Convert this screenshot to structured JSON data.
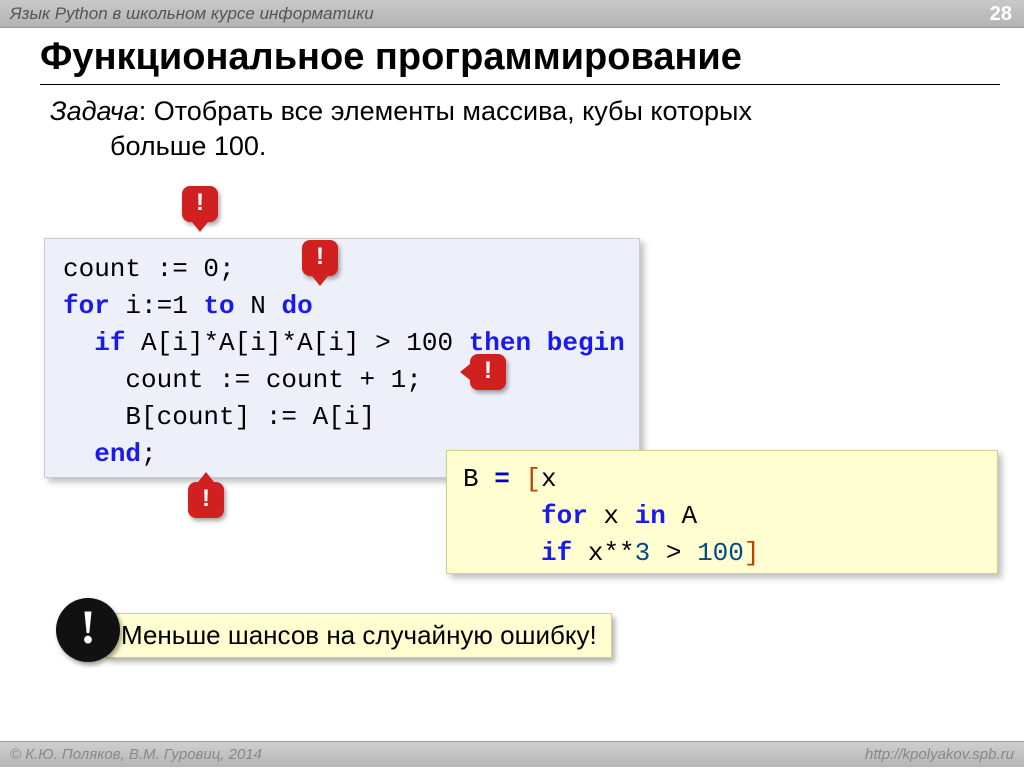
{
  "header": {
    "course": "Язык Python в школьном курсе информатики",
    "page": "28"
  },
  "title": "Функциональное программирование",
  "task": {
    "lead": "Задача",
    "line1": ": Отобрать все элементы массива, кубы которых",
    "line2": "больше 100."
  },
  "pascal": {
    "kw_for": "for",
    "kw_to": "to",
    "kw_do": "do",
    "kw_if": "if",
    "kw_then": "then",
    "kw_begin": "begin",
    "kw_end": "end",
    "line1a": "count := 0;",
    "line2_i": " i:=1 ",
    "line2_N": " N ",
    "line3_cond": " A[i]*A[i]*A[i] > 100 ",
    "line4": "    count := count + 1;",
    "line5": "    B[count] := A[i]",
    "semi": ";"
  },
  "python": {
    "lhs": "B ",
    "eq": "=",
    "lbr": " [",
    "rbr": "]",
    "x": "x",
    "kw_for": "for",
    "kw_in": "in",
    "kw_if": "if",
    "A": " A",
    "var_x2": " x ",
    "xpow": " x**",
    "n3": "3",
    "gt": " > ",
    "n100": "100",
    "pad": "     ",
    "pad2": "     "
  },
  "bubbles": {
    "b1": "!",
    "b2": "!",
    "b3": "!",
    "b4": "!"
  },
  "callout": {
    "mark": "!",
    "text": "Меньше шансов на случайную ошибку!"
  },
  "footer": {
    "credits": "© К.Ю. Поляков, В.М. Гуровиц, 2014",
    "url": "http://kpolyakov.spb.ru"
  }
}
